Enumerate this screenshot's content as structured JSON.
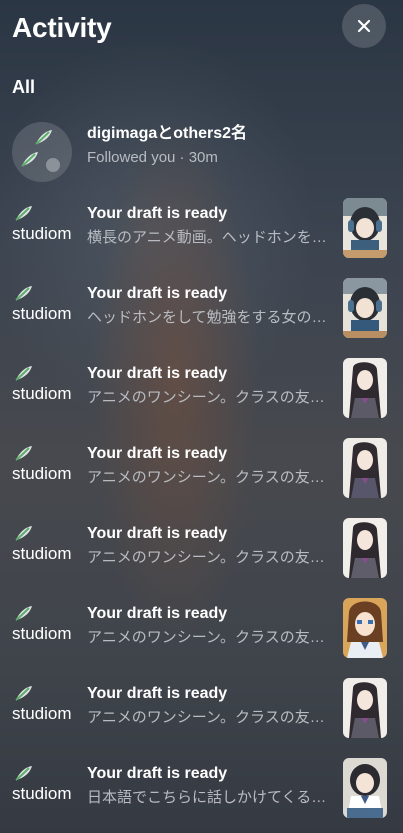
{
  "header": {
    "title": "Activity",
    "close_icon": "close-icon"
  },
  "filter": {
    "label": "All"
  },
  "notifications": [
    {
      "title": "digimagaとothers2名",
      "subtitle": "Followed you · 30m",
      "icon": "group-avatar"
    },
    {
      "app_name": "studiom",
      "title": "Your draft is ready",
      "subtitle": "横長のアニメ動画。ヘッドホンをし…",
      "thumb": "girl-dark-hair-headphones"
    },
    {
      "app_name": "studiom",
      "title": "Your draft is ready",
      "subtitle": "ヘッドホンをして勉強をする女の子…",
      "thumb": "girl-dark-hair-headphones"
    },
    {
      "app_name": "studiom",
      "title": "Your draft is ready",
      "subtitle": "アニメのワンシーン。クラスの友達…",
      "thumb": "girl-long-hair-uniform"
    },
    {
      "app_name": "studiom",
      "title": "Your draft is ready",
      "subtitle": "アニメのワンシーン。クラスの友達…",
      "thumb": "girl-long-hair-uniform"
    },
    {
      "app_name": "studiom",
      "title": "Your draft is ready",
      "subtitle": "アニメのワンシーン。クラスの友達…",
      "thumb": "girl-long-hair-uniform"
    },
    {
      "app_name": "studiom",
      "title": "Your draft is ready",
      "subtitle": "アニメのワンシーン。クラスの友達…",
      "thumb": "girl-brown-hair"
    },
    {
      "app_name": "studiom",
      "title": "Your draft is ready",
      "subtitle": "アニメのワンシーン。クラスの友達…",
      "thumb": "girl-long-hair-uniform"
    },
    {
      "app_name": "studiom",
      "title": "Your draft is ready",
      "subtitle": "日本語でこちらに話しかけてくる。…",
      "thumb": "girl-dark-hair-uniform"
    }
  ],
  "colors": {
    "text_primary": "#ffffff",
    "text_secondary": "#b8bcc2",
    "leaf_green": "#5fae6a"
  }
}
